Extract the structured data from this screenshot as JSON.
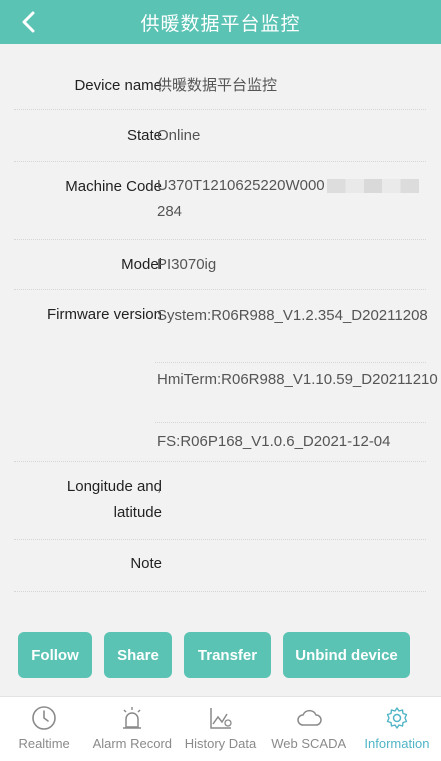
{
  "header": {
    "title": "供暖数据平台监控"
  },
  "details": {
    "device_name": {
      "label": "Device name",
      "value": "供暖数据平台监控"
    },
    "state": {
      "label": "State",
      "value": "Online"
    },
    "machine_code": {
      "label": "Machine Code",
      "value_line1": "U370T1210625220W000",
      "value_line2": "284"
    },
    "model": {
      "label": "Model",
      "value": "PI3070ig"
    },
    "firmware": {
      "label": "Firmware version",
      "items": [
        "System:R06R988_V1.2.354_D20211208",
        "HmiTerm:R06R988_V1.10.59_D20211210",
        "FS:R06P168_V1.0.6_D2021-12-04"
      ]
    },
    "location": {
      "label_line1": "Longitude and",
      "label_line2": "latitude",
      "value": ","
    },
    "note": {
      "label": "Note",
      "value": ""
    }
  },
  "actions": {
    "follow": "Follow",
    "share": "Share",
    "transfer": "Transfer",
    "unbind": "Unbind device"
  },
  "tabbar": {
    "items": [
      {
        "label": "Realtime",
        "icon": "clock-icon"
      },
      {
        "label": "Alarm Record",
        "icon": "alarm-icon"
      },
      {
        "label": "History Data",
        "icon": "chart-icon"
      },
      {
        "label": "Web SCADA",
        "icon": "cloud-icon"
      },
      {
        "label": "Information",
        "icon": "gear-icon"
      }
    ],
    "active": "Information"
  },
  "colors": {
    "accent": "#5ac3b4",
    "active_tab": "#4fb5c6"
  }
}
